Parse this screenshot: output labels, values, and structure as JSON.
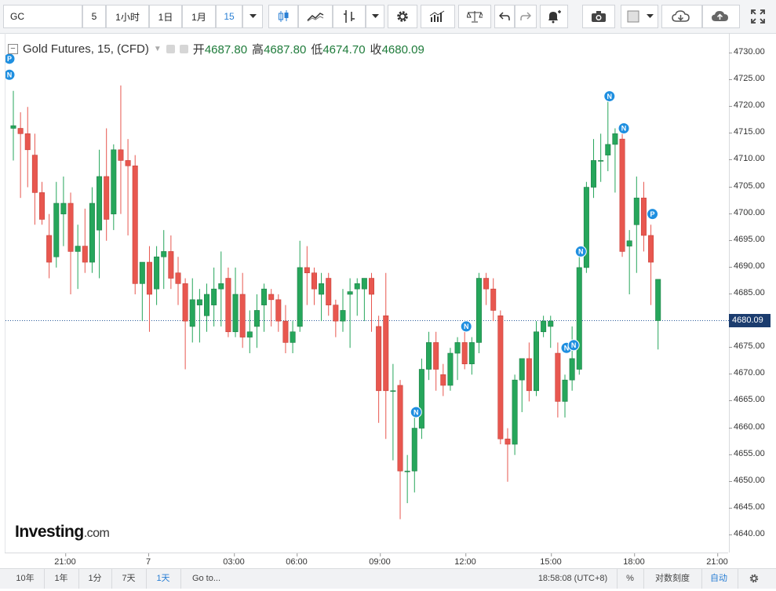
{
  "toolbar": {
    "symbol": "GC",
    "interval_value": "5",
    "buttons": [
      "1小时",
      "1日",
      "1月"
    ],
    "selected_interval": "15"
  },
  "legend": {
    "title": "Gold Futures, 15, (CFD)",
    "open_label": "开",
    "open_value": "4687.80",
    "high_label": "高",
    "high_value": "4687.80",
    "low_label": "低",
    "low_value": "4674.70",
    "close_label": "收",
    "close_value": "4680.09"
  },
  "price_axis": {
    "ticks": [
      "4730.00",
      "4725.00",
      "4720.00",
      "4715.00",
      "4710.00",
      "4705.00",
      "4700.00",
      "4695.00",
      "4690.00",
      "4685.00",
      "4680.00",
      "4675.00",
      "4670.00",
      "4665.00",
      "4660.00",
      "4655.00",
      "4650.00",
      "4645.00",
      "4640.00"
    ],
    "last_price": "4680.09"
  },
  "time_axis": {
    "ticks": [
      "21:00",
      "7",
      "03:00",
      "06:00",
      "09:00",
      "12:00",
      "15:00",
      "18:00",
      "21:00"
    ]
  },
  "watermark": {
    "brand": "Investing",
    "suffix": ".com"
  },
  "bottom_bar": {
    "ranges": [
      "10年",
      "1年",
      "1分",
      "7天",
      "1天"
    ],
    "active_range": "1天",
    "goto": "Go to...",
    "clock": "18:58:08 (UTC+8)",
    "percent": "%",
    "log_scale": "对数刻度",
    "auto": "自动"
  },
  "colors": {
    "up": "#26a65b",
    "down": "#e8574f",
    "accent": "#2a7fd4",
    "last_price_bg": "#1b3c6e",
    "marker": "#1f8fe0"
  },
  "chart_data": {
    "type": "candlestick",
    "ylim": [
      4638,
      4732
    ],
    "candles": [
      {
        "t": 0,
        "o": 4716,
        "h": 4723,
        "l": 4710,
        "c": 4716.5
      },
      {
        "t": 1,
        "o": 4716,
        "h": 4719,
        "l": 4703,
        "c": 4715
      },
      {
        "t": 2,
        "o": 4715,
        "h": 4720,
        "l": 4705,
        "c": 4712
      },
      {
        "t": 3,
        "o": 4711,
        "h": 4715,
        "l": 4698,
        "c": 4704
      },
      {
        "t": 4,
        "o": 4704,
        "h": 4706,
        "l": 4698,
        "c": 4699
      },
      {
        "t": 5,
        "o": 4696,
        "h": 4700,
        "l": 4688,
        "c": 4691
      },
      {
        "t": 6,
        "o": 4692,
        "h": 4706,
        "l": 4690,
        "c": 4702
      },
      {
        "t": 7,
        "o": 4700,
        "h": 4707,
        "l": 4694,
        "c": 4702
      },
      {
        "t": 8,
        "o": 4702,
        "h": 4704,
        "l": 4685,
        "c": 4693
      },
      {
        "t": 9,
        "o": 4693,
        "h": 4698,
        "l": 4686,
        "c": 4694
      },
      {
        "t": 10,
        "o": 4694,
        "h": 4701,
        "l": 4689,
        "c": 4691
      },
      {
        "t": 11,
        "o": 4691,
        "h": 4705,
        "l": 4689,
        "c": 4702
      },
      {
        "t": 12,
        "o": 4697,
        "h": 4712,
        "l": 4688,
        "c": 4707
      },
      {
        "t": 13,
        "o": 4707,
        "h": 4716,
        "l": 4695,
        "c": 4699
      },
      {
        "t": 14,
        "o": 4700,
        "h": 4713,
        "l": 4697,
        "c": 4712
      },
      {
        "t": 15,
        "o": 4712,
        "h": 4724,
        "l": 4700,
        "c": 4710
      },
      {
        "t": 16,
        "o": 4710,
        "h": 4714,
        "l": 4696,
        "c": 4709
      },
      {
        "t": 17,
        "o": 4709,
        "h": 4711,
        "l": 4685,
        "c": 4687
      },
      {
        "t": 18,
        "o": 4687,
        "h": 4690,
        "l": 4680,
        "c": 4691
      },
      {
        "t": 19,
        "o": 4691,
        "h": 4694,
        "l": 4678,
        "c": 4685
      },
      {
        "t": 20,
        "o": 4686,
        "h": 4694,
        "l": 4683,
        "c": 4692
      },
      {
        "t": 21,
        "o": 4692,
        "h": 4697,
        "l": 4686,
        "c": 4693
      },
      {
        "t": 22,
        "o": 4693,
        "h": 4696,
        "l": 4686,
        "c": 4688
      },
      {
        "t": 23,
        "o": 4689,
        "h": 4692,
        "l": 4683,
        "c": 4687
      },
      {
        "t": 24,
        "o": 4687,
        "h": 4688,
        "l": 4671,
        "c": 4680
      },
      {
        "t": 25,
        "o": 4679,
        "h": 4688,
        "l": 4676,
        "c": 4684
      },
      {
        "t": 26,
        "o": 4683,
        "h": 4686,
        "l": 4676,
        "c": 4684
      },
      {
        "t": 27,
        "o": 4681,
        "h": 4687,
        "l": 4678,
        "c": 4685
      },
      {
        "t": 28,
        "o": 4683,
        "h": 4690,
        "l": 4679,
        "c": 4686
      },
      {
        "t": 29,
        "o": 4686,
        "h": 4693,
        "l": 4679,
        "c": 4687
      },
      {
        "t": 30,
        "o": 4688,
        "h": 4690,
        "l": 4677,
        "c": 4678
      },
      {
        "t": 31,
        "o": 4678,
        "h": 4690,
        "l": 4677,
        "c": 4685
      },
      {
        "t": 32,
        "o": 4685,
        "h": 4689,
        "l": 4675,
        "c": 4677
      },
      {
        "t": 33,
        "o": 4677,
        "h": 4682,
        "l": 4674,
        "c": 4678
      },
      {
        "t": 34,
        "o": 4679,
        "h": 4685,
        "l": 4675,
        "c": 4682
      },
      {
        "t": 35,
        "o": 4683,
        "h": 4687,
        "l": 4678,
        "c": 4686
      },
      {
        "t": 36,
        "o": 4685,
        "h": 4686,
        "l": 4679,
        "c": 4684
      },
      {
        "t": 37,
        "o": 4684,
        "h": 4685,
        "l": 4678,
        "c": 4680
      },
      {
        "t": 38,
        "o": 4680,
        "h": 4683,
        "l": 4674,
        "c": 4676
      },
      {
        "t": 39,
        "o": 4676,
        "h": 4680,
        "l": 4674,
        "c": 4678
      },
      {
        "t": 40,
        "o": 4679,
        "h": 4695,
        "l": 4678,
        "c": 4690
      },
      {
        "t": 41,
        "o": 4690,
        "h": 4694,
        "l": 4683,
        "c": 4689
      },
      {
        "t": 42,
        "o": 4689,
        "h": 4690,
        "l": 4683,
        "c": 4686
      },
      {
        "t": 43,
        "o": 4685,
        "h": 4689,
        "l": 4680,
        "c": 4687
      },
      {
        "t": 44,
        "o": 4688,
        "h": 4689,
        "l": 4681,
        "c": 4683
      },
      {
        "t": 45,
        "o": 4683,
        "h": 4684,
        "l": 4677,
        "c": 4680
      },
      {
        "t": 46,
        "o": 4680,
        "h": 4686,
        "l": 4678,
        "c": 4682
      },
      {
        "t": 47,
        "o": 4685,
        "h": 4688,
        "l": 4675,
        "c": 4685.5
      },
      {
        "t": 48,
        "o": 4686,
        "h": 4688,
        "l": 4681,
        "c": 4687
      },
      {
        "t": 49,
        "o": 4686,
        "h": 4688,
        "l": 4680,
        "c": 4688
      },
      {
        "t": 50,
        "o": 4688,
        "h": 4689,
        "l": 4678,
        "c": 4685
      },
      {
        "t": 51,
        "o": 4679,
        "h": 4681,
        "l": 4661,
        "c": 4667
      },
      {
        "t": 52,
        "o": 4681,
        "h": 4689,
        "l": 4658,
        "c": 4667
      },
      {
        "t": 53,
        "o": 4667,
        "h": 4672,
        "l": 4654,
        "c": 4667
      },
      {
        "t": 54,
        "o": 4668,
        "h": 4669,
        "l": 4643,
        "c": 4652
      },
      {
        "t": 55,
        "o": 4652,
        "h": 4655,
        "l": 4646,
        "c": 4652
      },
      {
        "t": 56,
        "o": 4652,
        "h": 4662,
        "l": 4648,
        "c": 4660
      },
      {
        "t": 57,
        "o": 4660,
        "h": 4673,
        "l": 4658,
        "c": 4671
      },
      {
        "t": 58,
        "o": 4671,
        "h": 4678,
        "l": 4669,
        "c": 4676
      },
      {
        "t": 59,
        "o": 4676,
        "h": 4678,
        "l": 4667,
        "c": 4671
      },
      {
        "t": 60,
        "o": 4670,
        "h": 4672,
        "l": 4666,
        "c": 4668
      },
      {
        "t": 61,
        "o": 4668,
        "h": 4675,
        "l": 4667,
        "c": 4674
      },
      {
        "t": 62,
        "o": 4674,
        "h": 4677,
        "l": 4669,
        "c": 4676
      },
      {
        "t": 63,
        "o": 4676,
        "h": 4680,
        "l": 4671,
        "c": 4672
      },
      {
        "t": 64,
        "o": 4672,
        "h": 4677,
        "l": 4670,
        "c": 4676
      },
      {
        "t": 65,
        "o": 4676,
        "h": 4689,
        "l": 4674,
        "c": 4688
      },
      {
        "t": 66,
        "o": 4688,
        "h": 4689,
        "l": 4683,
        "c": 4686
      },
      {
        "t": 67,
        "o": 4686,
        "h": 4688,
        "l": 4680,
        "c": 4682
      },
      {
        "t": 68,
        "o": 4681,
        "h": 4682,
        "l": 4657,
        "c": 4658
      },
      {
        "t": 69,
        "o": 4658,
        "h": 4660,
        "l": 4650,
        "c": 4657
      },
      {
        "t": 70,
        "o": 4657,
        "h": 4670,
        "l": 4655,
        "c": 4669
      },
      {
        "t": 71,
        "o": 4669,
        "h": 4673,
        "l": 4663,
        "c": 4673
      },
      {
        "t": 72,
        "o": 4673,
        "h": 4676,
        "l": 4665,
        "c": 4667
      },
      {
        "t": 73,
        "o": 4667,
        "h": 4680,
        "l": 4666,
        "c": 4678
      },
      {
        "t": 74,
        "o": 4678,
        "h": 4681,
        "l": 4677,
        "c": 4680
      },
      {
        "t": 75,
        "o": 4679,
        "h": 4681,
        "l": 4675,
        "c": 4680
      },
      {
        "t": 76,
        "o": 4674,
        "h": 4676,
        "l": 4662,
        "c": 4665
      },
      {
        "t": 77,
        "o": 4665,
        "h": 4670,
        "l": 4662,
        "c": 4669
      },
      {
        "t": 78,
        "o": 4669,
        "h": 4679,
        "l": 4667,
        "c": 4673
      },
      {
        "t": 79,
        "o": 4671,
        "h": 4692,
        "l": 4670,
        "c": 4690
      },
      {
        "t": 80,
        "o": 4690,
        "h": 4706,
        "l": 4689,
        "c": 4705
      },
      {
        "t": 81,
        "o": 4705,
        "h": 4714,
        "l": 4703,
        "c": 4710
      },
      {
        "t": 82,
        "o": 4710,
        "h": 4715,
        "l": 4706,
        "c": 4710
      },
      {
        "t": 83,
        "o": 4711,
        "h": 4722,
        "l": 4708,
        "c": 4713
      },
      {
        "t": 84,
        "o": 4713,
        "h": 4716,
        "l": 4704,
        "c": 4715
      },
      {
        "t": 85,
        "o": 4714,
        "h": 4716,
        "l": 4692,
        "c": 4693
      },
      {
        "t": 86,
        "o": 4694,
        "h": 4697,
        "l": 4685,
        "c": 4695
      },
      {
        "t": 87,
        "o": 4698,
        "h": 4707,
        "l": 4689,
        "c": 4703
      },
      {
        "t": 88,
        "o": 4703,
        "h": 4706,
        "l": 4693,
        "c": 4696
      },
      {
        "t": 89,
        "o": 4696,
        "h": 4698,
        "l": 4683,
        "c": 4691
      },
      {
        "t": 90,
        "o": 4680.09,
        "h": 4687.8,
        "l": 4674.7,
        "c": 4687.8
      }
    ],
    "event_markers": [
      {
        "label": "P",
        "t": 0,
        "price": 4729
      },
      {
        "label": "N",
        "t": 0,
        "price": 4726
      },
      {
        "label": "N",
        "t": 56,
        "price": 4663
      },
      {
        "label": "N",
        "t": 63,
        "price": 4679
      },
      {
        "label": "N",
        "t": 79,
        "price": 4693
      },
      {
        "label": "N",
        "t": 77,
        "price": 4675
      },
      {
        "label": "N",
        "t": 78,
        "price": 4675.5
      },
      {
        "label": "N",
        "t": 83,
        "price": 4722
      },
      {
        "label": "N",
        "t": 85,
        "price": 4716
      },
      {
        "label": "P",
        "t": 89,
        "price": 4700
      }
    ]
  }
}
